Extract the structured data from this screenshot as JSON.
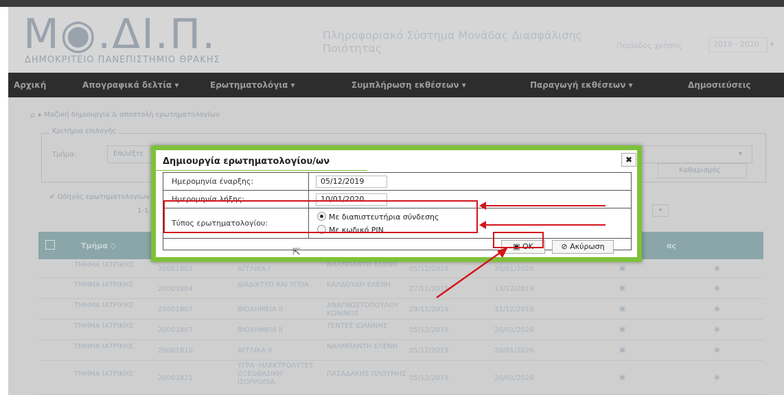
{
  "header": {
    "logo_text": "Μ◉.ΔΙ.Π.",
    "logo_subtitle": "ΔΗΜΟΚΡΙΤΕΙΟ ΠΑΝΕΠΙΣΤΗΜΙΟ ΘΡΑΚΗΣ",
    "system_title": "Πληροφοριακό Σύστημα Μονάδας Διασφάλισης Ποιότητας",
    "period_label": "Περίοδος χρήσης",
    "period_value": "2019 - 2020"
  },
  "menu": {
    "items": [
      "Αρχική",
      "Απογραφικά δελτία ▾",
      "Ερωτηματολόγια ▾",
      "Συμπλήρωση εκθέσεων ▾",
      "Παραγωγή εκθέσεων ▾",
      "Δημοσιεύσεις"
    ]
  },
  "page": {
    "breadcrumb": "▸ Μαζική δημιουργία & αποστολή ερωτηματολογίων",
    "criteria_legend": "Κριτήρια επιλογής",
    "dept_label": "Τμήμα:",
    "dept_select": "Επιλέξτε",
    "clear_button": "Καθαρισμός",
    "checkbox_label": "Οδηγός ερωτηματολογίων",
    "pagination": "1-1",
    "table_header_dept": "Τμήμα ◇",
    "table_header_extra": "ας"
  },
  "rows": [
    {
      "dept": "ΤΜΗΜΑ ΙΑΤΡΙΚΗΣ",
      "code": "20001802",
      "course": "ΑΓΓΛΙΚΑ I",
      "instructor": "ΝΑΛΜΠΑΝΤΗ ΕΛΕΝΗ",
      "start": "05/12/2019",
      "end": "20/01/2020"
    },
    {
      "dept": "ΤΜΗΜΑ ΙΑΤΡΙΚΗΣ",
      "code": "20001804",
      "course": "ΔΙΑΔΙΚΤΥΟ ΚΑΙ ΥΓΕΙΑ",
      "instructor": "ΚΑΛΔΟΥΔΗ ΕΛΕΝΗ",
      "start": "27/11/2019",
      "end": "13/12/2019"
    },
    {
      "dept": "ΤΜΗΜΑ ΙΑΤΡΙΚΗΣ",
      "code": "20001807",
      "course": "ΒΙΟΧΗΜΕΙΑ II",
      "instructor": "ΑΝΑΓΝΩΣΤΟΠΟΥΛΟΥ ΚΩΝ/ΝΟΣ",
      "start": "29/11/2019",
      "end": "31/12/2019"
    },
    {
      "dept": "ΤΜΗΜΑ ΙΑΤΡΙΚΗΣ",
      "code": "20001807",
      "course": "ΒΙΟΧΗΜΕΙΑ II",
      "instructor": "ΤΕΝΤΕΣ ΙΩΑΝΝΗΣ",
      "start": "05/12/2019",
      "end": "20/01/2020"
    },
    {
      "dept": "ΤΜΗΜΑ ΙΑΤΡΙΚΗΣ",
      "code": "20001810",
      "course": "ΑΓΓΛΙΚΑ II",
      "instructor": "ΝΑΛΜΠΑΝΤΗ ΕΛΕΝΗ",
      "start": "05/12/2019",
      "end": "20/01/2020"
    },
    {
      "dept": "ΤΜΗΜΑ ΙΑΤΡΙΚΗΣ",
      "code": "20001821",
      "course": "ΥΓΡΑ -ΗΛΕΚΤΡΟΛΥΤΕΣ ΟΞΕΟΒΑΣΙΚΗ ΙΣΟΡΡΟΠΙΑ",
      "instructor": "ΠΑΣΑΔΑΚΗΣ ΠΛΟΥΜΗΣ",
      "start": "05/12/2019",
      "end": "20/01/2020"
    }
  ],
  "modal": {
    "title": "Δημιουργία ερωτηματολογίου/ων",
    "close": "✖",
    "start_label": "Ημερομηνία έναρξης:",
    "start_value": "05/12/2019",
    "end_label": "Ημερομηνία λήξης:",
    "end_value": "10/01/2020",
    "type_label": "Τύπος ερωτηματολογίου:",
    "option_1": "Με διαπιστευτήρια σύνδεσης",
    "option_2": "Με κωδικό PIN",
    "selected_option": "option_1",
    "ok_label": "OK",
    "cancel_label": "Ακύρωση"
  },
  "colors": {
    "modal_border": "#7ec13a",
    "highlight": "#d4131b",
    "menubar": "#2d2d2d"
  }
}
